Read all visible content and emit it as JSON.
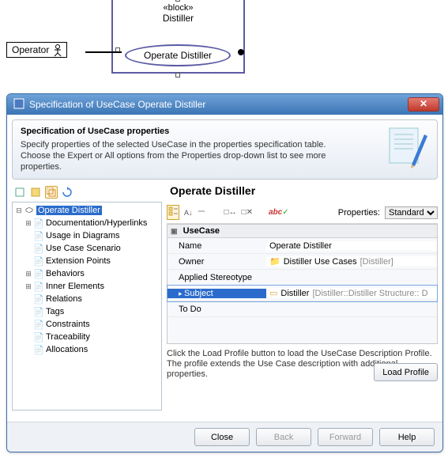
{
  "uml": {
    "actor": "Operator",
    "block_stereotype": "«block»",
    "block_name": "Distiller",
    "usecase": "Operate Distiller"
  },
  "dialog": {
    "title": "Specification of UseCase Operate Distiller",
    "header_title": "Specification of UseCase properties",
    "header_text": "Specify properties of the selected UseCase in the properties specification table. Choose the Expert or All options from the Properties drop-down list to see more properties."
  },
  "tree": [
    {
      "exp": "−",
      "icon": "⬭",
      "label": "Operate Distiller",
      "selected": true,
      "indent": false
    },
    {
      "exp": "+",
      "icon": "📄",
      "label": "Documentation/Hyperlinks",
      "indent": true
    },
    {
      "exp": "",
      "icon": "📄",
      "label": "Usage in Diagrams",
      "indent": true
    },
    {
      "exp": "",
      "icon": "📄",
      "label": "Use Case Scenario",
      "indent": true
    },
    {
      "exp": "",
      "icon": "📄",
      "label": "Extension Points",
      "indent": true
    },
    {
      "exp": "+",
      "icon": "📄",
      "label": "Behaviors",
      "indent": true
    },
    {
      "exp": "+",
      "icon": "📄",
      "label": "Inner Elements",
      "indent": true
    },
    {
      "exp": "",
      "icon": "📄",
      "label": "Relations",
      "indent": true
    },
    {
      "exp": "",
      "icon": "📄",
      "label": "Tags",
      "indent": true
    },
    {
      "exp": "",
      "icon": "📄",
      "label": "Constraints",
      "indent": true
    },
    {
      "exp": "",
      "icon": "📄",
      "label": "Traceability",
      "indent": true
    },
    {
      "exp": "",
      "icon": "📄",
      "label": "Allocations",
      "indent": true
    }
  ],
  "right": {
    "title": "Operate Distiller",
    "properties_label": "Properties:",
    "properties_value": "Standard",
    "section": "UseCase",
    "rows": [
      {
        "name": "Name",
        "value": "Operate Distiller",
        "icon": "",
        "muted": "",
        "selected": false
      },
      {
        "name": "Owner",
        "value": "Distiller Use Cases",
        "icon": "📁",
        "muted": "[Distiller]",
        "selected": false
      },
      {
        "name": "Applied Stereotype",
        "value": "",
        "icon": "",
        "muted": "",
        "selected": false
      },
      {
        "name": "Subject",
        "value": "Distiller",
        "icon": "▭",
        "muted": "[Distiller::Distiller Structure:: D",
        "selected": true
      },
      {
        "name": "To Do",
        "value": "",
        "icon": "",
        "muted": "",
        "selected": false
      }
    ],
    "hint": "Click the Load Profile button to load the UseCase Description Profile. The profile extends the Use Case description with additional properties.",
    "load_btn": "Load Profile"
  },
  "footer": {
    "close": "Close",
    "back": "Back",
    "forward": "Forward",
    "help": "Help"
  }
}
